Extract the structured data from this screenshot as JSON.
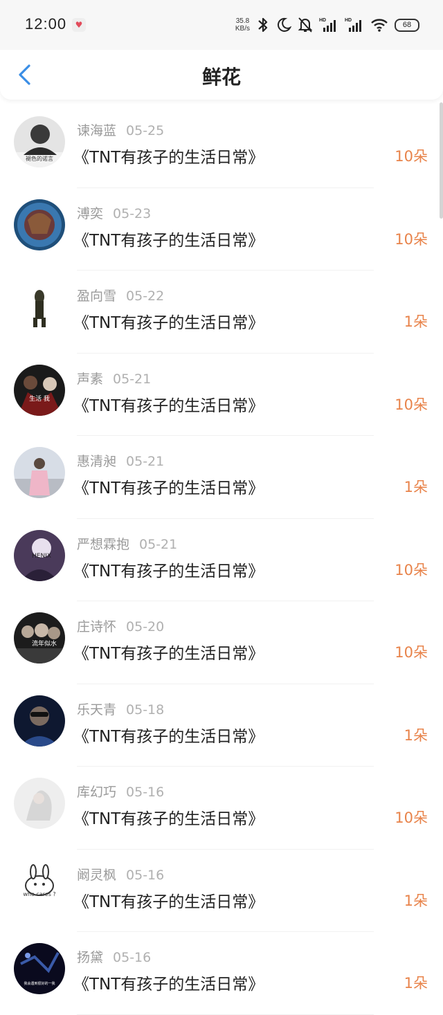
{
  "status_bar": {
    "time": "12:00",
    "net_speed_value": "35.8",
    "net_speed_unit": "KB/s",
    "battery": "68",
    "icons": [
      "heart-notification-icon",
      "bluetooth-icon",
      "moon-icon",
      "bell-mute-icon",
      "hd-signal-icon",
      "hd-signal-icon",
      "wifi-icon",
      "battery-icon"
    ]
  },
  "header": {
    "title": "鲜花",
    "back_icon": "chevron-left-icon"
  },
  "colors": {
    "accent_blue": "#3a8ee6",
    "flower_orange": "#e8834a",
    "meta_gray": "#9a9a9a"
  },
  "records": [
    {
      "name": "谏海蓝",
      "date": "05-25",
      "book": "《TNT有孩子的生活日常》",
      "flowers": "10朵",
      "avatar_caption": "褪色的诺言"
    },
    {
      "name": "溥奕",
      "date": "05-23",
      "book": "《TNT有孩子的生活日常》",
      "flowers": "10朵",
      "avatar_caption": ""
    },
    {
      "name": "盈向雪",
      "date": "05-22",
      "book": "《TNT有孩子的生活日常》",
      "flowers": "1朵",
      "avatar_caption": ""
    },
    {
      "name": "声素",
      "date": "05-21",
      "book": "《TNT有孩子的生活日常》",
      "flowers": "10朵",
      "avatar_caption": "生活   我"
    },
    {
      "name": "惠清昶",
      "date": "05-21",
      "book": "《TNT有孩子的生活日常》",
      "flowers": "1朵",
      "avatar_caption": ""
    },
    {
      "name": "严想霖抱",
      "date": "05-21",
      "book": "《TNT有孩子的生活日常》",
      "flowers": "10朵",
      "avatar_caption": "HENIX"
    },
    {
      "name": "庄诗怀",
      "date": "05-20",
      "book": "《TNT有孩子的生活日常》",
      "flowers": "10朵",
      "avatar_caption": "流年似水"
    },
    {
      "name": "乐天青",
      "date": "05-18",
      "book": "《TNT有孩子的生活日常》",
      "flowers": "1朵",
      "avatar_caption": ""
    },
    {
      "name": "库幻巧",
      "date": "05-16",
      "book": "《TNT有孩子的生活日常》",
      "flowers": "10朵",
      "avatar_caption": ""
    },
    {
      "name": "阚灵枫",
      "date": "05-16",
      "book": "《TNT有孩子的生活日常》",
      "flowers": "1朵",
      "avatar_caption": "who cares ?"
    },
    {
      "name": "扬黛",
      "date": "05-16",
      "book": "《TNT有孩子的生活日常》",
      "flowers": "1朵",
      "avatar_caption": "我会遇到很好的一我"
    }
  ]
}
